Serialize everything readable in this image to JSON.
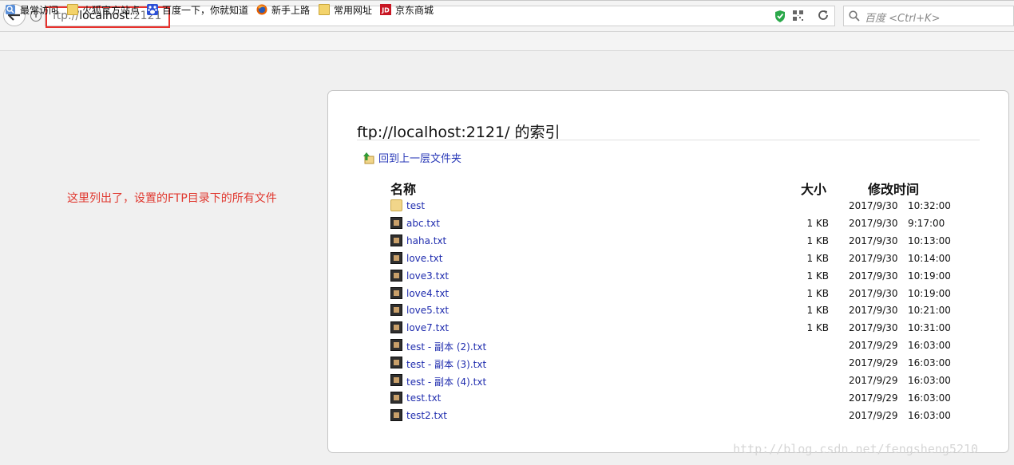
{
  "browser": {
    "url_scheme": "ftp://",
    "url_host": "localhost",
    "url_port": ":2121",
    "search_placeholder": "百度 <Ctrl+K>"
  },
  "bookmarks": [
    {
      "label": "最常访问",
      "icon": "most-visited-icon"
    },
    {
      "label": "火狐官方站点",
      "icon": "folder-icon"
    },
    {
      "label": "百度一下，你就知道",
      "icon": "baidu-icon"
    },
    {
      "label": "新手上路",
      "icon": "firefox-icon"
    },
    {
      "label": "常用网址",
      "icon": "folder-icon"
    },
    {
      "label": "京东商城",
      "icon": "jd-icon"
    }
  ],
  "annotation": "这里列出了，设置的FTP目录下的所有文件",
  "listing": {
    "title": "ftp://localhost:2121/ 的索引",
    "up_label": "回到上一层文件夹",
    "headers": {
      "name": "名称",
      "size": "大小",
      "modified": "修改时间"
    },
    "rows": [
      {
        "name": "test",
        "type": "folder",
        "size": "",
        "date": "2017/9/30",
        "time": "10:32:00"
      },
      {
        "name": "abc.txt",
        "type": "file",
        "size": "1 KB",
        "date": "2017/9/30",
        "time": "9:17:00"
      },
      {
        "name": "haha.txt",
        "type": "file",
        "size": "1 KB",
        "date": "2017/9/30",
        "time": "10:13:00"
      },
      {
        "name": "love.txt",
        "type": "file",
        "size": "1 KB",
        "date": "2017/9/30",
        "time": "10:14:00"
      },
      {
        "name": "love3.txt",
        "type": "file",
        "size": "1 KB",
        "date": "2017/9/30",
        "time": "10:19:00"
      },
      {
        "name": "love4.txt",
        "type": "file",
        "size": "1 KB",
        "date": "2017/9/30",
        "time": "10:19:00"
      },
      {
        "name": "love5.txt",
        "type": "file",
        "size": "1 KB",
        "date": "2017/9/30",
        "time": "10:21:00"
      },
      {
        "name": "love7.txt",
        "type": "file",
        "size": "1 KB",
        "date": "2017/9/30",
        "time": "10:31:00"
      },
      {
        "name": "test - 副本 (2).txt",
        "type": "file",
        "size": "",
        "date": "2017/9/29",
        "time": "16:03:00"
      },
      {
        "name": "test - 副本 (3).txt",
        "type": "file",
        "size": "",
        "date": "2017/9/29",
        "time": "16:03:00"
      },
      {
        "name": "test - 副本 (4).txt",
        "type": "file",
        "size": "",
        "date": "2017/9/29",
        "time": "16:03:00"
      },
      {
        "name": "test.txt",
        "type": "file",
        "size": "",
        "date": "2017/9/29",
        "time": "16:03:00"
      },
      {
        "name": "test2.txt",
        "type": "file",
        "size": "",
        "date": "2017/9/29",
        "time": "16:03:00"
      }
    ]
  },
  "watermark": "http://blog.csdn.net/fengsheng5210",
  "colors": {
    "link": "#1f2cae",
    "annotation": "#e0382f",
    "highlight": "#e8312c"
  }
}
